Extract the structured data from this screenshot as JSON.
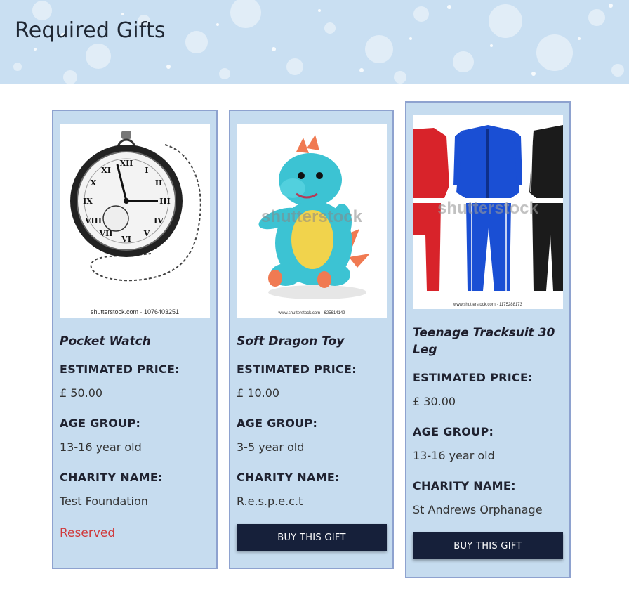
{
  "page": {
    "title": "Required Gifts"
  },
  "gifts": [
    {
      "name": "Pocket Watch",
      "image_caption": "shutterstock.com · 1076403251",
      "price_label": "ESTIMATED PRICE:",
      "price": "£ 50.00",
      "age_label": "AGE GROUP:",
      "age": "13-16 year old",
      "charity_label": "CHARITY NAME:",
      "charity": "Test Foundation",
      "status": "Reserved"
    },
    {
      "name": "Soft Dragon Toy",
      "image_caption": "www.shutterstock.com · 625614149",
      "image_watermark": "shutterstock",
      "price_label": "ESTIMATED PRICE:",
      "price": "£ 10.00",
      "age_label": "AGE GROUP:",
      "age": "3-5 year old",
      "charity_label": "CHARITY NAME:",
      "charity": "R.e.s.p.e.c.t",
      "button": "BUY THIS GIFT"
    },
    {
      "name": "Teenage Tracksuit 30 Leg",
      "image_caption": "www.shutterstock.com · 1175288173",
      "image_watermark": "shutterstock",
      "price_label": "ESTIMATED PRICE:",
      "price": "£ 30.00",
      "age_label": "AGE GROUP:",
      "age": "13-16 year old",
      "charity_label": "CHARITY NAME:",
      "charity": "St Andrews Orphanage",
      "button": "BUY THIS GIFT"
    }
  ],
  "colors": {
    "banner": "#c9dff2",
    "card_bg": "#c6dcef",
    "card_border": "#8ea2cf",
    "button_bg": "#16203a",
    "reserved": "#d0393b"
  }
}
